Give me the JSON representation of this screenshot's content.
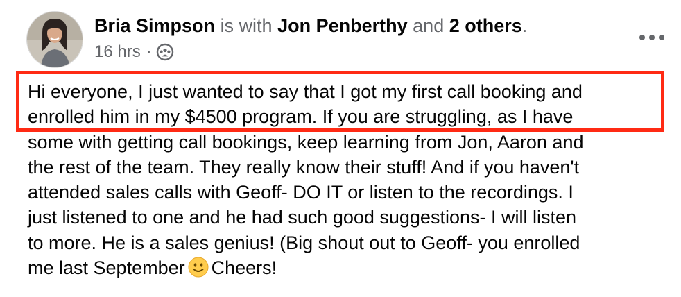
{
  "post": {
    "author": "Bria Simpson",
    "with_connector": "is with",
    "tagged": "Jon Penberthy",
    "and_connector": "and",
    "others": "2 others",
    "period": ".",
    "timestamp": "16 hrs",
    "separator": "·",
    "audience_icon": "group-audience-icon",
    "more_icon": "more-options-icon",
    "text_before_emoji": "Hi everyone, I just wanted to say that I got my first call booking and\nenrolled him in my $4500 program.  If you are struggling, as I have\nsome with getting call bookings, keep learning from Jon, Aaron and\nthe rest of the team.  They really know their stuff! And if you haven't\nattended sales calls with Geoff-  DO IT or listen to the recordings. I\njust listened to one and he had such good suggestions- I will listen\nto more.  He is a sales genius! (Big shout out to Geoff- you enrolled\nme last September",
    "emoji": "slightly-smiling-face-emoji",
    "text_after_emoji": "Cheers!"
  },
  "colors": {
    "highlight_border": "#ff2a14",
    "muted_text": "#65676b",
    "emoji_yellow": "#ffcc4d"
  }
}
